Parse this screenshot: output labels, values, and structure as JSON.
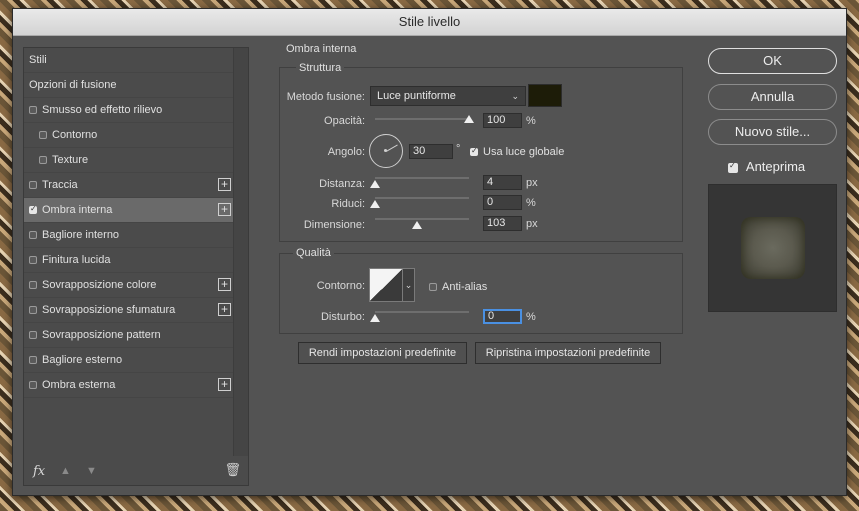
{
  "window": {
    "title": "Stile livello"
  },
  "left_panel": {
    "items": [
      {
        "label": "Stili",
        "checkbox": false,
        "checked": false,
        "plus": false,
        "indent": false,
        "selected": false
      },
      {
        "label": "Opzioni di fusione",
        "checkbox": false,
        "checked": false,
        "plus": false,
        "indent": false,
        "selected": false
      },
      {
        "label": "Smusso ed effetto rilievo",
        "checkbox": true,
        "checked": false,
        "plus": false,
        "indent": false,
        "selected": false
      },
      {
        "label": "Contorno",
        "checkbox": true,
        "checked": false,
        "plus": false,
        "indent": true,
        "selected": false
      },
      {
        "label": "Texture",
        "checkbox": true,
        "checked": false,
        "plus": false,
        "indent": true,
        "selected": false
      },
      {
        "label": "Traccia",
        "checkbox": true,
        "checked": false,
        "plus": true,
        "indent": false,
        "selected": false
      },
      {
        "label": "Ombra interna",
        "checkbox": true,
        "checked": true,
        "plus": true,
        "indent": false,
        "selected": true
      },
      {
        "label": "Bagliore interno",
        "checkbox": true,
        "checked": false,
        "plus": false,
        "indent": false,
        "selected": false
      },
      {
        "label": "Finitura lucida",
        "checkbox": true,
        "checked": false,
        "plus": false,
        "indent": false,
        "selected": false
      },
      {
        "label": "Sovrapposizione colore",
        "checkbox": true,
        "checked": false,
        "plus": true,
        "indent": false,
        "selected": false
      },
      {
        "label": "Sovrapposizione sfumatura",
        "checkbox": true,
        "checked": false,
        "plus": true,
        "indent": false,
        "selected": false
      },
      {
        "label": "Sovrapposizione pattern",
        "checkbox": true,
        "checked": false,
        "plus": false,
        "indent": false,
        "selected": false
      },
      {
        "label": "Bagliore esterno",
        "checkbox": true,
        "checked": false,
        "plus": false,
        "indent": false,
        "selected": false
      },
      {
        "label": "Ombra esterna",
        "checkbox": true,
        "checked": false,
        "plus": true,
        "indent": false,
        "selected": false
      }
    ],
    "footer": {
      "fx_label": "fx",
      "up_icon": "arrow-up-icon",
      "down_icon": "arrow-down-icon",
      "trash_icon": "trash-icon"
    }
  },
  "inner_shadow": {
    "section_title": "Ombra interna",
    "structure": {
      "title": "Struttura",
      "blend_mode": {
        "label": "Metodo fusione:",
        "value": "Luce puntiforme"
      },
      "color": "#1d1c08",
      "opacity": {
        "label": "Opacità:",
        "value": "100",
        "unit": "%",
        "fraction": 1.0
      },
      "angle": {
        "label": "Angolo:",
        "value": "30",
        "unit": "°",
        "global_light_label": "Usa luce globale",
        "global_light_checked": true
      },
      "distance": {
        "label": "Distanza:",
        "value": "4",
        "unit": "px",
        "fraction": 0.0
      },
      "choke": {
        "label": "Riduci:",
        "value": "0",
        "unit": "%",
        "fraction": 0.0
      },
      "size": {
        "label": "Dimensione:",
        "value": "103",
        "unit": "px",
        "fraction": 0.45
      }
    },
    "quality": {
      "title": "Qualità",
      "contour_label": "Contorno:",
      "antialias_label": "Anti-alias",
      "antialias_checked": false,
      "noise": {
        "label": "Disturbo:",
        "value": "0",
        "unit": "%",
        "fraction": 0.0
      }
    },
    "buttons": {
      "make_default": "Rendi impostazioni predefinite",
      "reset_default": "Ripristina impostazioni predefinite"
    }
  },
  "right_panel": {
    "ok": "OK",
    "cancel": "Annulla",
    "new_style": "Nuovo stile...",
    "preview_label": "Anteprima",
    "preview_checked": true
  }
}
